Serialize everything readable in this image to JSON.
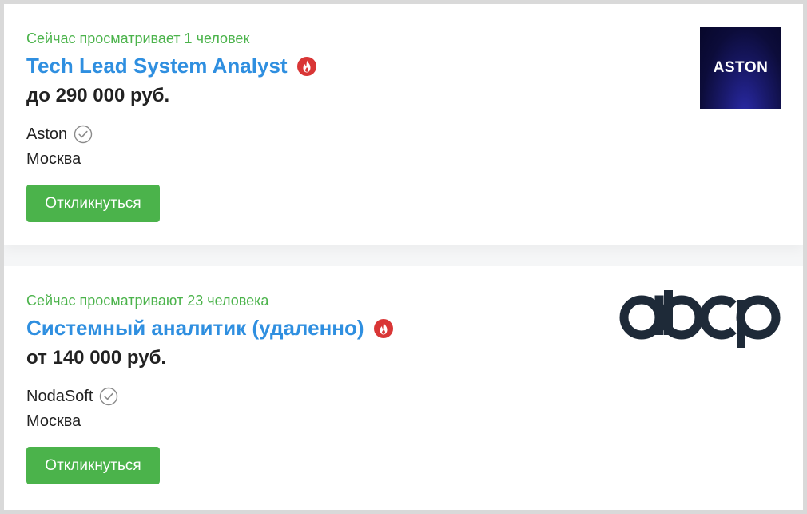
{
  "vacancies": [
    {
      "viewers": "Сейчас просматривает 1 человек",
      "title": "Tech Lead System Analyst",
      "salary": "до 290 000 руб.",
      "company": "Aston",
      "city": "Москва",
      "apply_label": "Откликнуться",
      "logo_text": "ASTON",
      "hot_icon": "flame-icon",
      "verified_icon": "verified-check-icon"
    },
    {
      "viewers": "Сейчас просматривают 23 человека",
      "title": "Системный аналитик (удаленно)",
      "salary": "от 140 000 руб.",
      "company": "NodaSoft",
      "city": "Москва",
      "apply_label": "Откликнуться",
      "logo_text": "abcp",
      "hot_icon": "flame-icon",
      "verified_icon": "verified-check-icon"
    }
  ],
  "colors": {
    "accent_green": "#4bb34b",
    "link_blue": "#2f8fe0",
    "hot_red": "#d93636",
    "aston_navy": "#0c0c3a"
  }
}
